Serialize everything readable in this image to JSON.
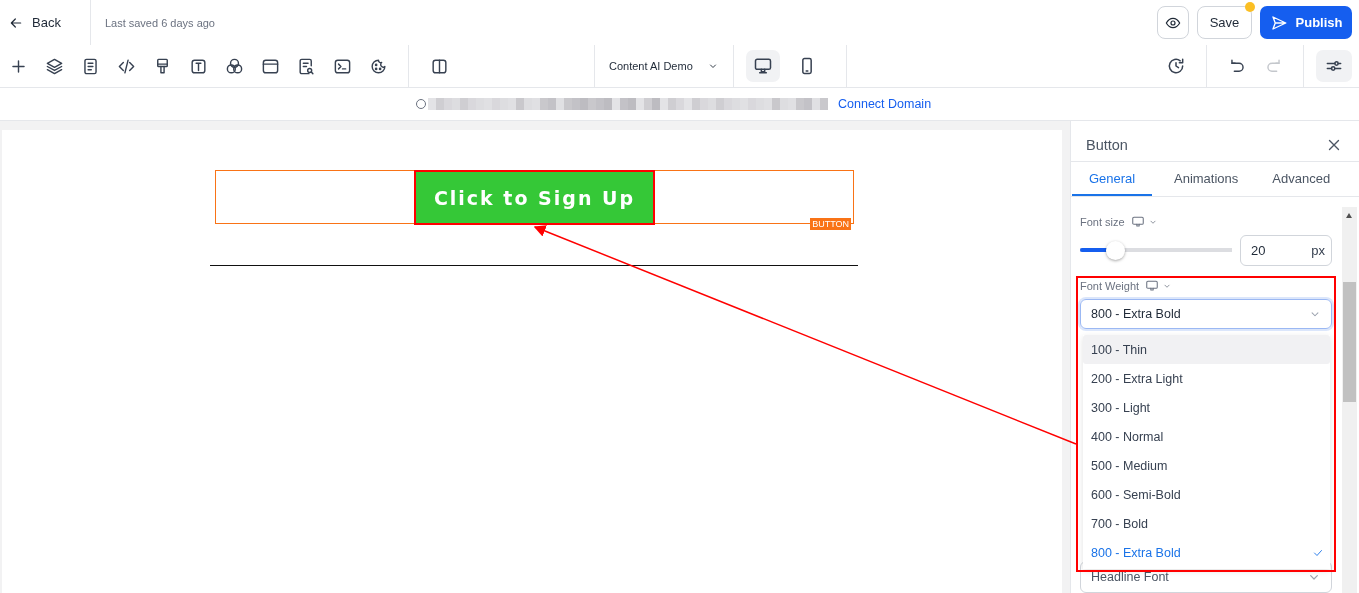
{
  "top_bar": {
    "back": "Back",
    "last_saved": "Last saved 6 days ago",
    "save": "Save",
    "unsaved": true,
    "publish": "Publish"
  },
  "toolbar": {
    "project": "Content AI Demo",
    "devices": [
      {
        "kind": "desktop",
        "selected": true
      },
      {
        "kind": "mobile",
        "selected": false
      }
    ],
    "redo_disabled": true
  },
  "url_bar": {
    "link": "Connect Domain"
  },
  "canvas": {
    "button_label": "Click to Sign Up",
    "badge": "BUTTON",
    "selected": true
  },
  "panel": {
    "title": "Button",
    "tabs": [
      {
        "label": "General",
        "selected": true
      },
      {
        "label": "Animations",
        "selected": false
      },
      {
        "label": "Advanced",
        "selected": false
      }
    ],
    "font_size": {
      "label": "Font size",
      "level": 0.23,
      "value": "20",
      "unit": "px"
    },
    "font_weight": {
      "label": "Font Weight",
      "value": "800 - Extra Bold",
      "expanded": true,
      "options": [
        {
          "label": "100 - Thin",
          "highlighted": true,
          "selected": false
        },
        {
          "label": "200 - Extra Light",
          "highlighted": false,
          "selected": false
        },
        {
          "label": "300 - Light",
          "highlighted": false,
          "selected": false
        },
        {
          "label": "400 - Normal",
          "highlighted": false,
          "selected": false
        },
        {
          "label": "500 - Medium",
          "highlighted": false,
          "selected": false
        },
        {
          "label": "600 - Semi-Bold",
          "highlighted": false,
          "selected": false
        },
        {
          "label": "700 - Bold",
          "highlighted": false,
          "selected": false
        },
        {
          "label": "800 - Extra Bold",
          "highlighted": false,
          "selected": true
        }
      ]
    },
    "headline_font": {
      "value": "Headline Font"
    }
  }
}
